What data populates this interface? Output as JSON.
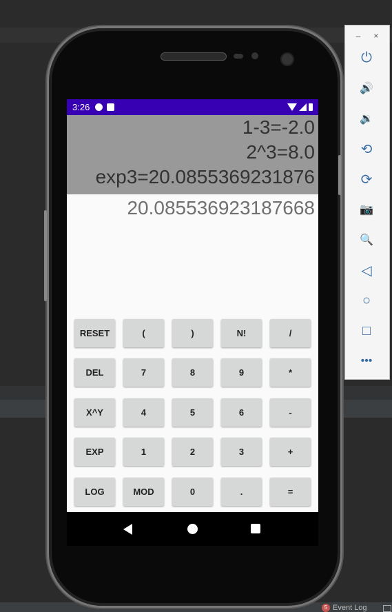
{
  "ide": {
    "event_log": {
      "count": "5",
      "label": "Event Log"
    }
  },
  "device": {
    "statusbar": {
      "time": "3:26"
    },
    "history": [
      "1-3=-2.0",
      "2^3=8.0",
      "exp3=20.0855369231876"
    ],
    "result": "20.085536923187668",
    "keypad": {
      "row1": [
        "RESET",
        "(",
        ")",
        "N!",
        "/"
      ],
      "row2": [
        "DEL",
        "7",
        "8",
        "9",
        "*"
      ],
      "row3": [
        "X^Y",
        "4",
        "5",
        "6",
        "-"
      ],
      "row4": [
        "EXP",
        "1",
        "2",
        "3",
        "+"
      ],
      "row5": [
        "LOG",
        "MOD",
        "0",
        ".",
        "="
      ]
    }
  },
  "emulator_panel": {
    "window_controls": {
      "minimize": "–",
      "close": "×"
    },
    "tools": {
      "power": "⏻",
      "volume_up": "🔊",
      "volume_down": "🔉",
      "rotate_left": "⟲",
      "rotate_right": "⟳",
      "screenshot": "📷",
      "zoom": "🔍",
      "back": "◁",
      "home": "○",
      "overview": "□",
      "more": "•••"
    }
  },
  "colors": {
    "statusbar": "#3700b3",
    "history_bg": "#999999",
    "key_bg": "#d6d7d7"
  }
}
